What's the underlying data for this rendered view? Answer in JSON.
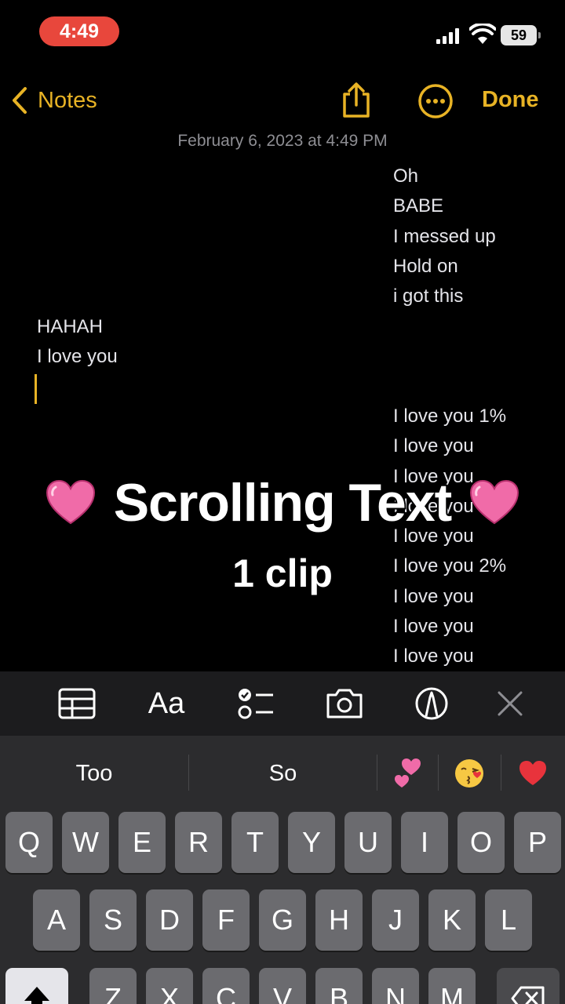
{
  "status": {
    "time": "4:49",
    "battery": "59"
  },
  "nav": {
    "back_label": "Notes",
    "done_label": "Done"
  },
  "note": {
    "date": "February 6, 2023 at 4:49 PM",
    "right_lines_top": [
      "Oh",
      "BABE",
      "I messed up",
      "Hold on",
      "i got this"
    ],
    "left_lines": [
      "HAHAH",
      "I love you"
    ],
    "right_lines_bottom": [
      "I love you 1%",
      "I love you",
      "I love you",
      "I love you",
      "I love you",
      "I love you 2%",
      "I love you",
      "I love you",
      "I love you"
    ]
  },
  "overlay": {
    "title": "Scrolling Text",
    "subtitle": "1 clip"
  },
  "toolbar": {
    "format_label": "Aa"
  },
  "suggestions": [
    "Too",
    "So"
  ],
  "keyboard": {
    "row1": [
      "Q",
      "W",
      "E",
      "R",
      "T",
      "Y",
      "U",
      "I",
      "O",
      "P"
    ],
    "row2": [
      "A",
      "S",
      "D",
      "F",
      "G",
      "H",
      "J",
      "K",
      "L"
    ],
    "row3": [
      "Z",
      "X",
      "C",
      "V",
      "B",
      "N",
      "M"
    ]
  },
  "colors": {
    "accent": "#e8b325",
    "time_pill": "#e8473c",
    "heart": "#f06ba8"
  }
}
